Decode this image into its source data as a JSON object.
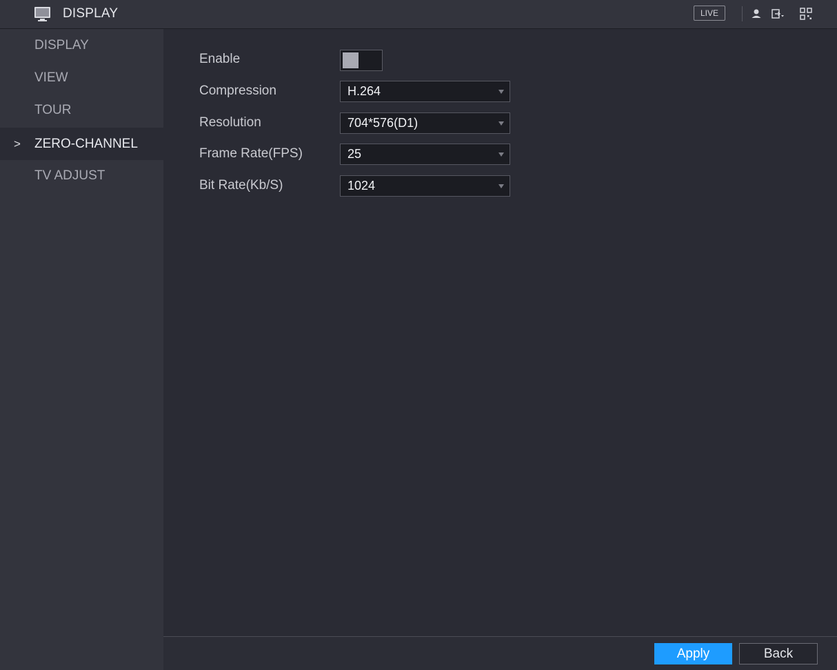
{
  "header": {
    "title": "DISPLAY",
    "app_icon": "monitor-icon",
    "live_label": "LIVE",
    "icons": [
      "user-icon",
      "logout-icon",
      "qr-code-icon"
    ]
  },
  "sidebar": {
    "items": [
      {
        "label": "DISPLAY"
      },
      {
        "label": "VIEW"
      },
      {
        "label": "TOUR"
      },
      {
        "label": "ZERO-CHANNEL",
        "active": true,
        "marker": ">"
      },
      {
        "label": "TV ADJUST"
      }
    ]
  },
  "form": {
    "enable": {
      "label": "Enable",
      "on": false
    },
    "compression": {
      "label": "Compression",
      "value": "H.264"
    },
    "resolution": {
      "label": "Resolution",
      "value": "704*576(D1)"
    },
    "frame_rate": {
      "label": "Frame Rate(FPS)",
      "value": "25"
    },
    "bit_rate": {
      "label": "Bit Rate(Kb/S)",
      "value": "1024"
    }
  },
  "footer": {
    "apply_label": "Apply",
    "back_label": "Back"
  },
  "colors": {
    "accent": "#1e9cff",
    "background": "#2a2b34",
    "panel": "#33343d"
  }
}
